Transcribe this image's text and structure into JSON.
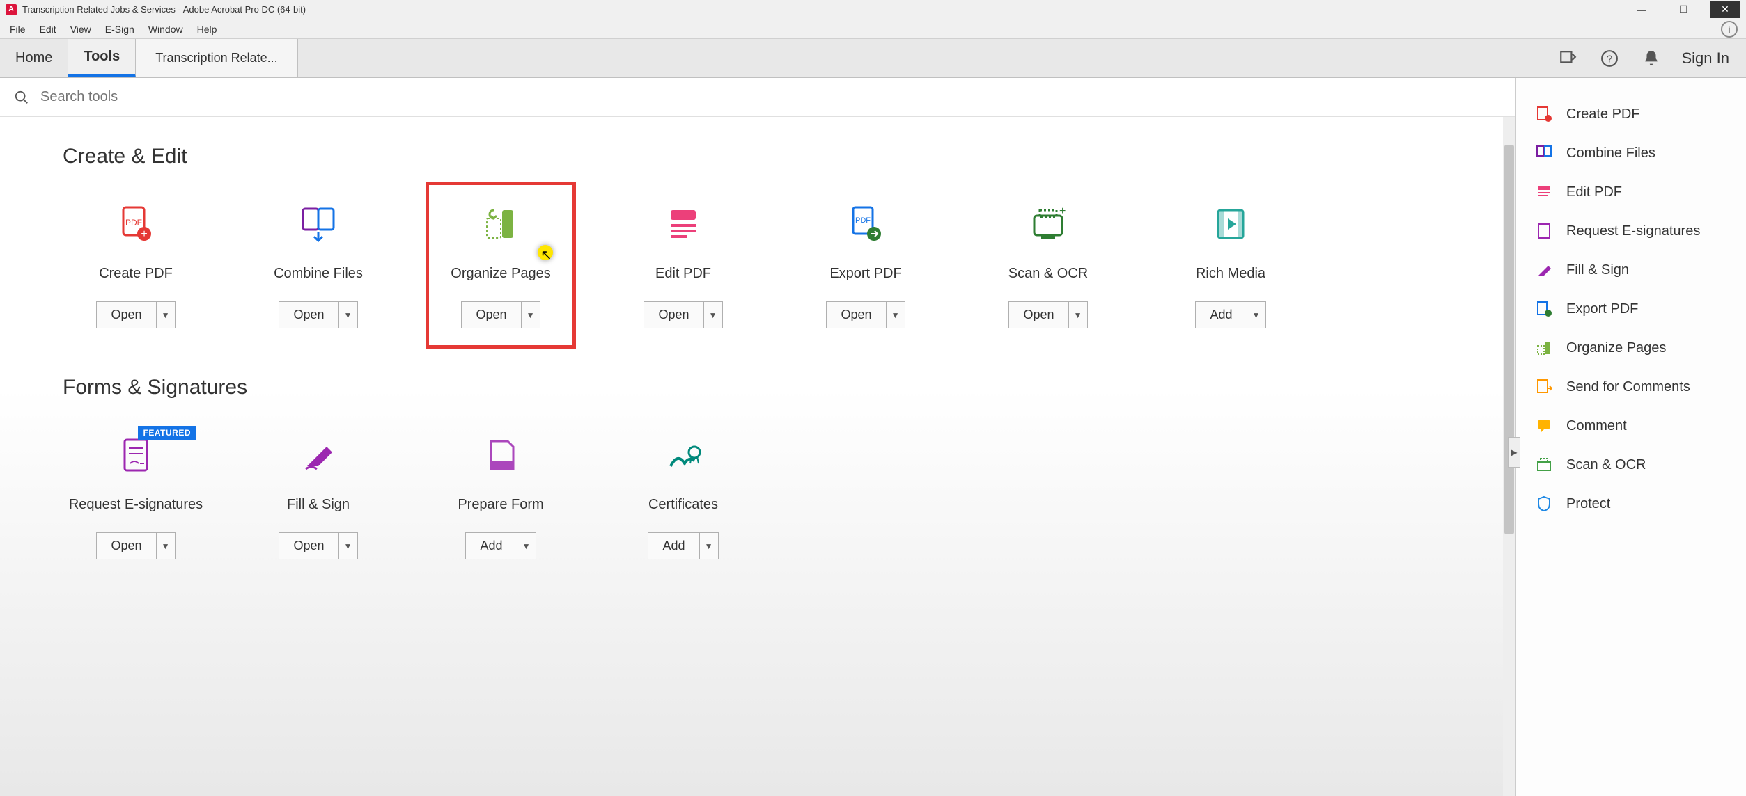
{
  "titlebar": {
    "title": "Transcription Related Jobs & Services - Adobe Acrobat Pro DC (64-bit)"
  },
  "menubar": [
    "File",
    "Edit",
    "View",
    "E-Sign",
    "Window",
    "Help"
  ],
  "tabs": {
    "home": "Home",
    "tools": "Tools",
    "doc": "Transcription Relate...",
    "signin": "Sign In"
  },
  "search": {
    "placeholder": "Search tools"
  },
  "sections": {
    "create_edit": {
      "title": "Create & Edit",
      "cards": [
        {
          "label": "Create PDF",
          "action": "Open"
        },
        {
          "label": "Combine Files",
          "action": "Open"
        },
        {
          "label": "Organize Pages",
          "action": "Open",
          "highlighted": true
        },
        {
          "label": "Edit PDF",
          "action": "Open"
        },
        {
          "label": "Export PDF",
          "action": "Open"
        },
        {
          "label": "Scan & OCR",
          "action": "Open"
        },
        {
          "label": "Rich Media",
          "action": "Add"
        }
      ]
    },
    "forms": {
      "title": "Forms & Signatures",
      "cards": [
        {
          "label": "Request E-signatures",
          "action": "Open",
          "featured": "FEATURED"
        },
        {
          "label": "Fill & Sign",
          "action": "Open"
        },
        {
          "label": "Prepare Form",
          "action": "Add"
        },
        {
          "label": "Certificates",
          "action": "Add"
        }
      ]
    }
  },
  "sidebar": [
    "Create PDF",
    "Combine Files",
    "Edit PDF",
    "Request E-signatures",
    "Fill & Sign",
    "Export PDF",
    "Organize Pages",
    "Send for Comments",
    "Comment",
    "Scan & OCR",
    "Protect"
  ],
  "icons": {
    "side_colors": [
      "#e53935",
      "#1473e6",
      "#d81b60",
      "#9c27b0",
      "#7b1fa2",
      "#1473e6",
      "#7cb342",
      "#ff9800",
      "#ffb300",
      "#43a047",
      "#1e88e5"
    ]
  }
}
